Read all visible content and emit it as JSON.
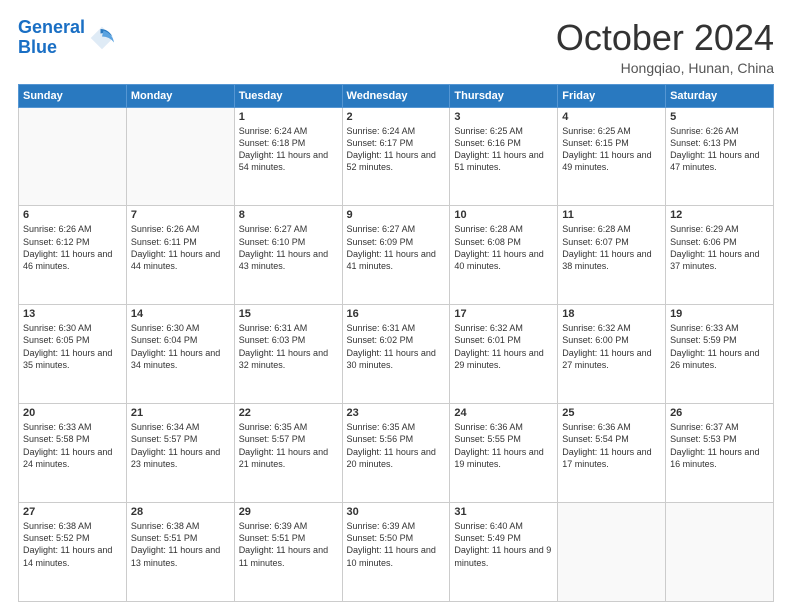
{
  "header": {
    "logo_line1": "General",
    "logo_line2": "Blue",
    "month": "October 2024",
    "location": "Hongqiao, Hunan, China"
  },
  "weekdays": [
    "Sunday",
    "Monday",
    "Tuesday",
    "Wednesday",
    "Thursday",
    "Friday",
    "Saturday"
  ],
  "weeks": [
    [
      {
        "day": "",
        "info": ""
      },
      {
        "day": "",
        "info": ""
      },
      {
        "day": "1",
        "info": "Sunrise: 6:24 AM\nSunset: 6:18 PM\nDaylight: 11 hours and 54 minutes."
      },
      {
        "day": "2",
        "info": "Sunrise: 6:24 AM\nSunset: 6:17 PM\nDaylight: 11 hours and 52 minutes."
      },
      {
        "day": "3",
        "info": "Sunrise: 6:25 AM\nSunset: 6:16 PM\nDaylight: 11 hours and 51 minutes."
      },
      {
        "day": "4",
        "info": "Sunrise: 6:25 AM\nSunset: 6:15 PM\nDaylight: 11 hours and 49 minutes."
      },
      {
        "day": "5",
        "info": "Sunrise: 6:26 AM\nSunset: 6:13 PM\nDaylight: 11 hours and 47 minutes."
      }
    ],
    [
      {
        "day": "6",
        "info": "Sunrise: 6:26 AM\nSunset: 6:12 PM\nDaylight: 11 hours and 46 minutes."
      },
      {
        "day": "7",
        "info": "Sunrise: 6:26 AM\nSunset: 6:11 PM\nDaylight: 11 hours and 44 minutes."
      },
      {
        "day": "8",
        "info": "Sunrise: 6:27 AM\nSunset: 6:10 PM\nDaylight: 11 hours and 43 minutes."
      },
      {
        "day": "9",
        "info": "Sunrise: 6:27 AM\nSunset: 6:09 PM\nDaylight: 11 hours and 41 minutes."
      },
      {
        "day": "10",
        "info": "Sunrise: 6:28 AM\nSunset: 6:08 PM\nDaylight: 11 hours and 40 minutes."
      },
      {
        "day": "11",
        "info": "Sunrise: 6:28 AM\nSunset: 6:07 PM\nDaylight: 11 hours and 38 minutes."
      },
      {
        "day": "12",
        "info": "Sunrise: 6:29 AM\nSunset: 6:06 PM\nDaylight: 11 hours and 37 minutes."
      }
    ],
    [
      {
        "day": "13",
        "info": "Sunrise: 6:30 AM\nSunset: 6:05 PM\nDaylight: 11 hours and 35 minutes."
      },
      {
        "day": "14",
        "info": "Sunrise: 6:30 AM\nSunset: 6:04 PM\nDaylight: 11 hours and 34 minutes."
      },
      {
        "day": "15",
        "info": "Sunrise: 6:31 AM\nSunset: 6:03 PM\nDaylight: 11 hours and 32 minutes."
      },
      {
        "day": "16",
        "info": "Sunrise: 6:31 AM\nSunset: 6:02 PM\nDaylight: 11 hours and 30 minutes."
      },
      {
        "day": "17",
        "info": "Sunrise: 6:32 AM\nSunset: 6:01 PM\nDaylight: 11 hours and 29 minutes."
      },
      {
        "day": "18",
        "info": "Sunrise: 6:32 AM\nSunset: 6:00 PM\nDaylight: 11 hours and 27 minutes."
      },
      {
        "day": "19",
        "info": "Sunrise: 6:33 AM\nSunset: 5:59 PM\nDaylight: 11 hours and 26 minutes."
      }
    ],
    [
      {
        "day": "20",
        "info": "Sunrise: 6:33 AM\nSunset: 5:58 PM\nDaylight: 11 hours and 24 minutes."
      },
      {
        "day": "21",
        "info": "Sunrise: 6:34 AM\nSunset: 5:57 PM\nDaylight: 11 hours and 23 minutes."
      },
      {
        "day": "22",
        "info": "Sunrise: 6:35 AM\nSunset: 5:57 PM\nDaylight: 11 hours and 21 minutes."
      },
      {
        "day": "23",
        "info": "Sunrise: 6:35 AM\nSunset: 5:56 PM\nDaylight: 11 hours and 20 minutes."
      },
      {
        "day": "24",
        "info": "Sunrise: 6:36 AM\nSunset: 5:55 PM\nDaylight: 11 hours and 19 minutes."
      },
      {
        "day": "25",
        "info": "Sunrise: 6:36 AM\nSunset: 5:54 PM\nDaylight: 11 hours and 17 minutes."
      },
      {
        "day": "26",
        "info": "Sunrise: 6:37 AM\nSunset: 5:53 PM\nDaylight: 11 hours and 16 minutes."
      }
    ],
    [
      {
        "day": "27",
        "info": "Sunrise: 6:38 AM\nSunset: 5:52 PM\nDaylight: 11 hours and 14 minutes."
      },
      {
        "day": "28",
        "info": "Sunrise: 6:38 AM\nSunset: 5:51 PM\nDaylight: 11 hours and 13 minutes."
      },
      {
        "day": "29",
        "info": "Sunrise: 6:39 AM\nSunset: 5:51 PM\nDaylight: 11 hours and 11 minutes."
      },
      {
        "day": "30",
        "info": "Sunrise: 6:39 AM\nSunset: 5:50 PM\nDaylight: 11 hours and 10 minutes."
      },
      {
        "day": "31",
        "info": "Sunrise: 6:40 AM\nSunset: 5:49 PM\nDaylight: 11 hours and 9 minutes."
      },
      {
        "day": "",
        "info": ""
      },
      {
        "day": "",
        "info": ""
      }
    ]
  ]
}
